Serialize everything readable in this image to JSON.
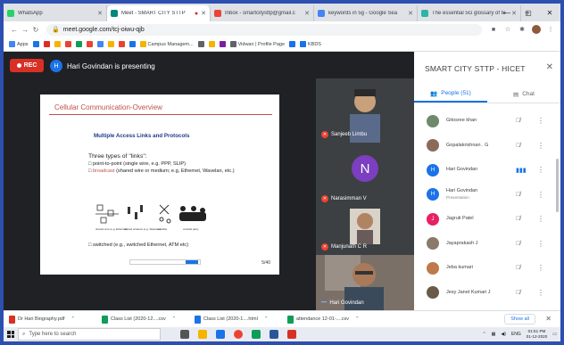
{
  "browser": {
    "tabs": [
      {
        "label": "WhatsApp",
        "color": "#25d366",
        "active": false
      },
      {
        "label": "Meet - SMART CITY STTP",
        "color": "#00897b",
        "active": true
      },
      {
        "label": "Inbox - smartcitysttp@gmail.c",
        "color": "#ea4335",
        "active": false
      },
      {
        "label": "keywords in 5g - Google Sea",
        "color": "#4285f4",
        "active": false
      },
      {
        "label": "The essential 5G glossary of te",
        "color": "#2bb5a5",
        "active": false
      }
    ],
    "new_tab": "+",
    "url": "meet.google.com/tcj-oiwu-qjb",
    "bookmarks": [
      {
        "label": "Apps",
        "color": "#4285f4"
      },
      {
        "label": "",
        "color": "#1a73e8"
      },
      {
        "label": "",
        "color": "#d93025"
      },
      {
        "label": "",
        "color": "#f4b400"
      },
      {
        "label": "",
        "color": "#ea4335"
      },
      {
        "label": "",
        "color": "#0f9d58"
      },
      {
        "label": "",
        "color": "#ea4335"
      },
      {
        "label": "",
        "color": "#4285f4"
      },
      {
        "label": "",
        "color": "#f4b400"
      },
      {
        "label": "",
        "color": "#ea4335"
      },
      {
        "label": "",
        "color": "#1a73e8"
      },
      {
        "label": "Campus Managem...",
        "color": "#f4b400"
      },
      {
        "label": "",
        "color": "#5f6368"
      },
      {
        "label": "",
        "color": "#f4b400"
      },
      {
        "label": "",
        "color": "#7b1fa2"
      },
      {
        "label": "Vidwan | Profile Page",
        "color": "#5f6368"
      },
      {
        "label": "",
        "color": "#1a73e8"
      },
      {
        "label": "KBDS",
        "color": "#1a73e8"
      }
    ]
  },
  "meet": {
    "rec_label": "REC",
    "presenter_initial": "H",
    "presenter_text": "Hari Govindan is presenting",
    "slide": {
      "title": "Cellular Communication-Overview",
      "subtitle": "Multiple Access Links and Protocols",
      "heading": "Three types of \"links\":",
      "bullet1": "point-to-point (single wire, e.g. PPP, SLIP)",
      "bullet2_red": "broadcast",
      "bullet2_rest": " (shared wire or medium; e.g, Ethernet, Wavelan, etc.)",
      "bullet3": "switched (e.g., switched Ethernet, ATM etc)",
      "page": "5/40",
      "diagram_labels": [
        "shared wire (e.g. Ethernet)",
        "shared wireless (e.g. Wavelan)",
        "satellite",
        "cocktail party"
      ]
    },
    "tiles": [
      {
        "name": "Sanjeeb Limbu",
        "type": "photo"
      },
      {
        "name": "Narasimman V",
        "type": "initial",
        "initial": "N"
      },
      {
        "name": "Manjunath C R",
        "type": "photo"
      },
      {
        "name": "Hari Govindan",
        "type": "photo"
      }
    ]
  },
  "panel": {
    "title": "SMART CITY STTP - HICET",
    "tab_people": "People (51)",
    "tab_chat": "Chat",
    "participants": [
      {
        "name": "Gitosree khan",
        "sub": "",
        "avatar_color": "#6d8a6a",
        "initial": "",
        "mic": "off"
      },
      {
        "name": "Gopalakrishnan . G",
        "sub": "",
        "avatar_color": "#8c6a5a",
        "initial": "",
        "mic": "off"
      },
      {
        "name": "Hari Govindan",
        "sub": "",
        "avatar_color": "#1a73e8",
        "initial": "H",
        "mic": "on"
      },
      {
        "name": "Hari Govindan",
        "sub": "Presentation",
        "avatar_color": "#1a73e8",
        "initial": "H",
        "mic": "off"
      },
      {
        "name": "Jagruti Patel",
        "sub": "",
        "avatar_color": "#e91e63",
        "initial": "J",
        "mic": "off"
      },
      {
        "name": "Jayaprakash J",
        "sub": "",
        "avatar_color": "#8a7a6a",
        "initial": "",
        "mic": "off"
      },
      {
        "name": "Jeba kumari",
        "sub": "",
        "avatar_color": "#c0794a",
        "initial": "",
        "mic": "off"
      },
      {
        "name": "Jesy Janet Kumari J",
        "sub": "",
        "avatar_color": "#6a5a4a",
        "initial": "",
        "mic": "off"
      }
    ]
  },
  "downloads": {
    "items": [
      {
        "label": "Dr Hari Biography.pdf",
        "color": "#d93025"
      },
      {
        "label": "Class List (2020-12....csv",
        "color": "#0f9d58"
      },
      {
        "label": "Class List (2020-1....html",
        "color": "#1a73e8"
      },
      {
        "label": "attendance 12-01-....csv",
        "color": "#0f9d58"
      }
    ],
    "show_all": "Show all"
  },
  "taskbar": {
    "search_placeholder": "Type here to search",
    "lang": "ENG",
    "time": "01:51 PM",
    "date": "01-12-2020"
  }
}
